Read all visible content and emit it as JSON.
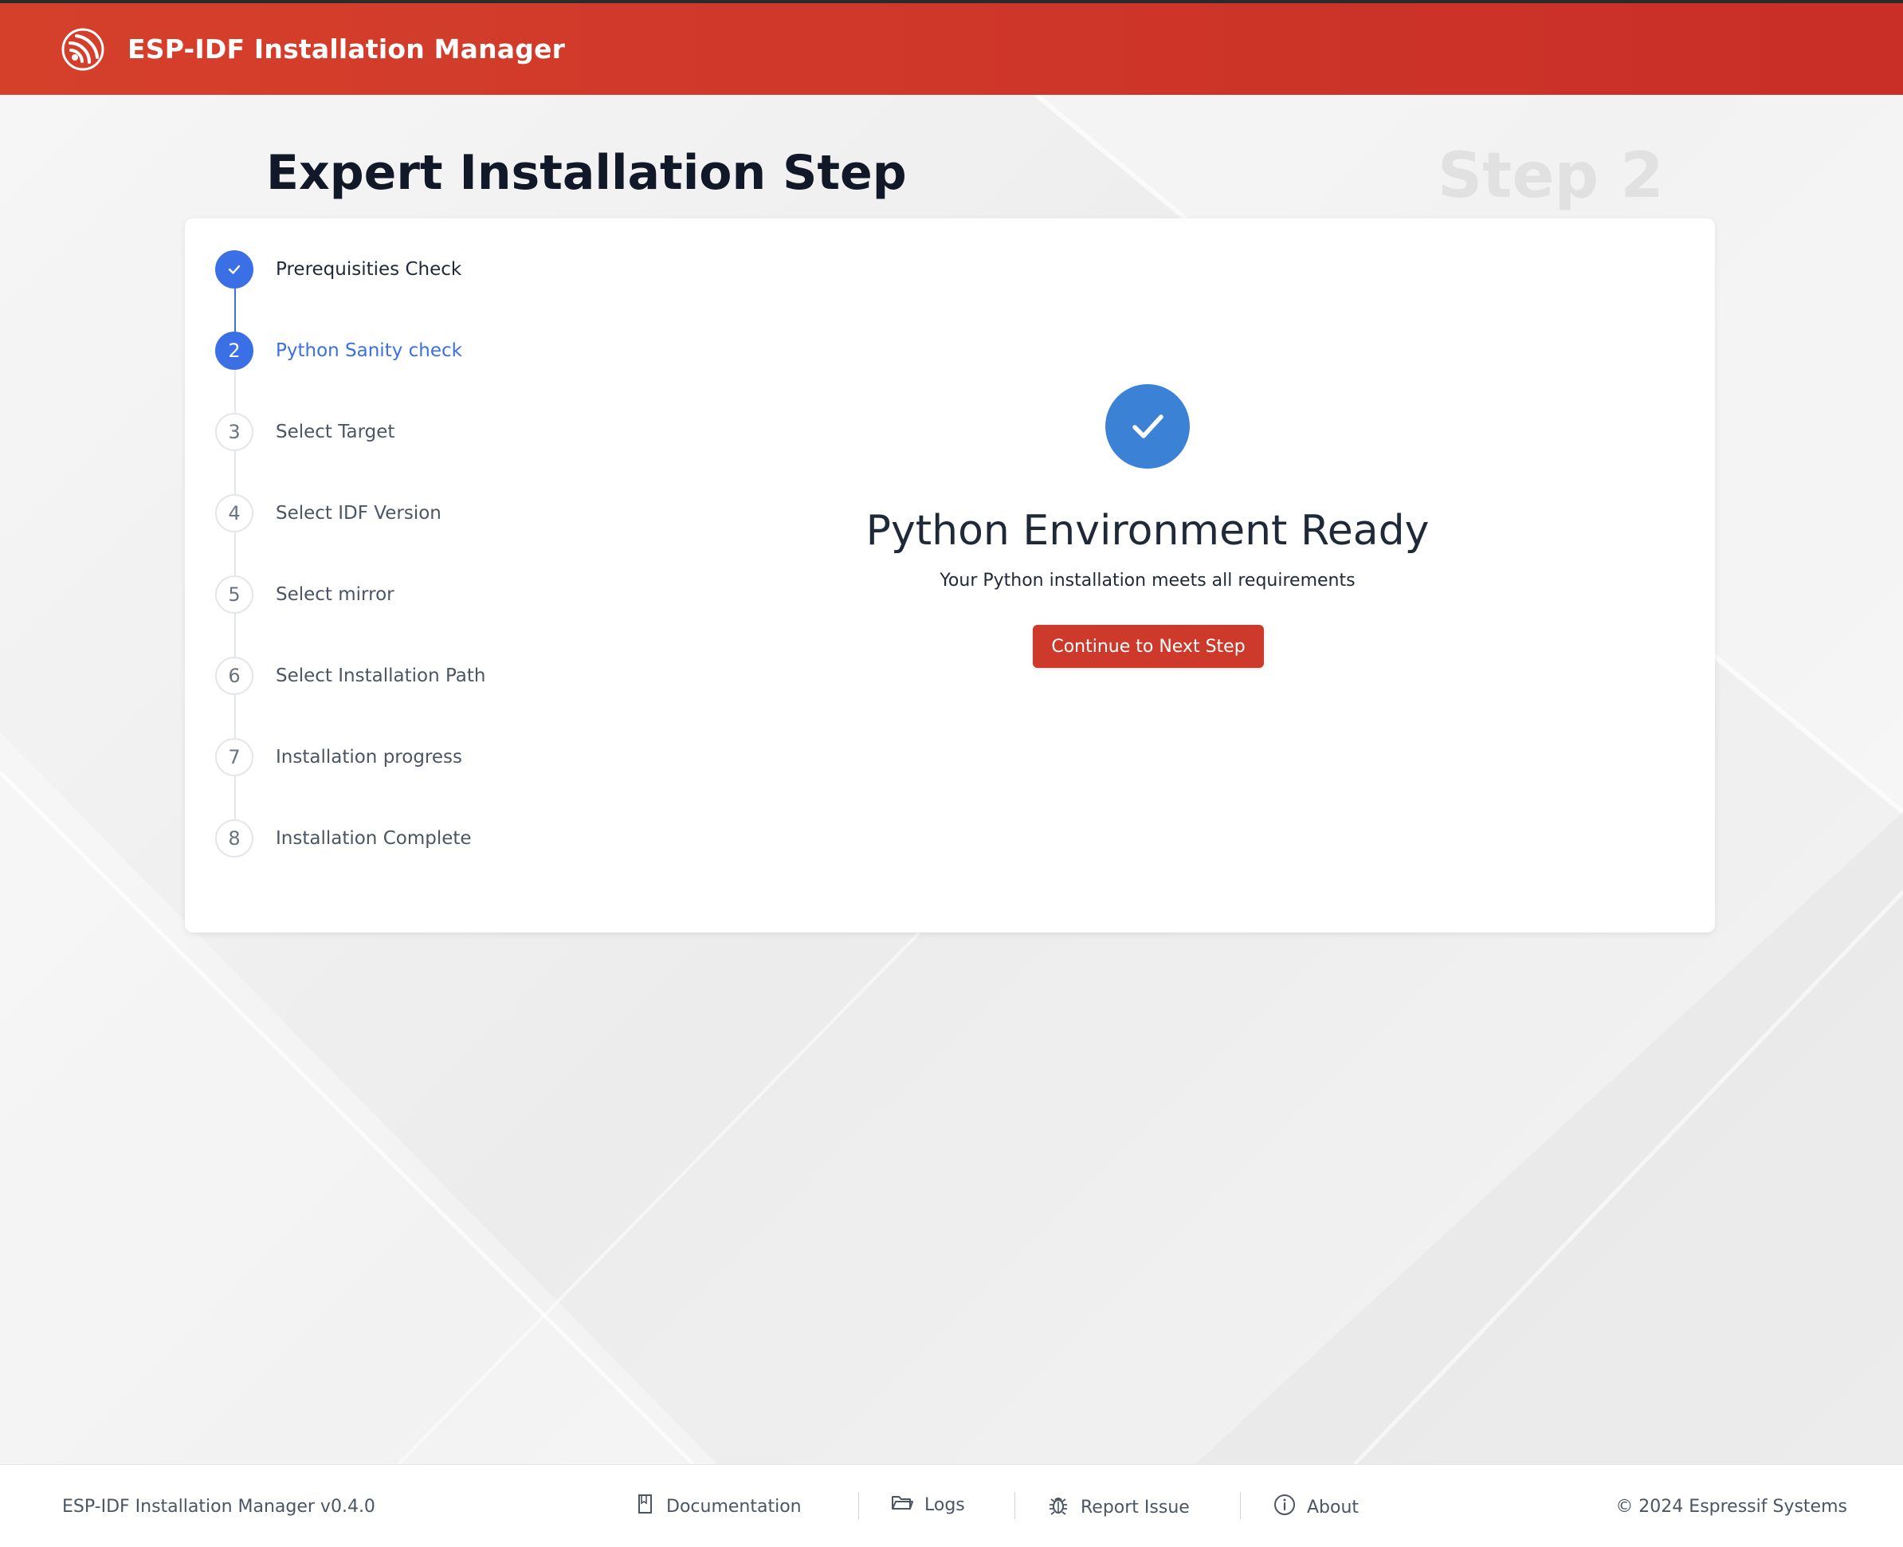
{
  "header": {
    "app_title": "ESP-IDF Installation Manager",
    "logo_icon": "espressif-logo-icon"
  },
  "page": {
    "title": "Expert Installation Step",
    "step_watermark": "Step 2"
  },
  "wizard": {
    "current_step": 2,
    "steps": [
      {
        "number": "1",
        "label": "Prerequisities Check",
        "state": "done"
      },
      {
        "number": "2",
        "label": "Python Sanity check",
        "state": "active"
      },
      {
        "number": "3",
        "label": "Select Target",
        "state": "pending"
      },
      {
        "number": "4",
        "label": "Select IDF Version",
        "state": "pending"
      },
      {
        "number": "5",
        "label": "Select mirror",
        "state": "pending"
      },
      {
        "number": "6",
        "label": "Select Installation Path",
        "state": "pending"
      },
      {
        "number": "7",
        "label": "Installation progress",
        "state": "pending"
      },
      {
        "number": "8",
        "label": "Installation Complete",
        "state": "pending"
      }
    ]
  },
  "result": {
    "icon": "checkmark-circle-icon",
    "title": "Python Environment Ready",
    "subtitle": "Your Python installation meets all requirements",
    "continue_label": "Continue to Next Step"
  },
  "footer": {
    "version": "ESP-IDF Installation Manager v0.4.0",
    "links": [
      {
        "label": "Documentation",
        "icon": "book-icon"
      },
      {
        "label": "Logs",
        "icon": "folder-icon"
      },
      {
        "label": "Report Issue",
        "icon": "bug-icon"
      },
      {
        "label": "About",
        "icon": "info-icon"
      }
    ],
    "copyright": "© 2024 Espressif Systems"
  },
  "colors": {
    "brand_red": "#cd3a2b",
    "accent_blue": "#3b6fe6",
    "success_blue": "#3b82d6"
  }
}
